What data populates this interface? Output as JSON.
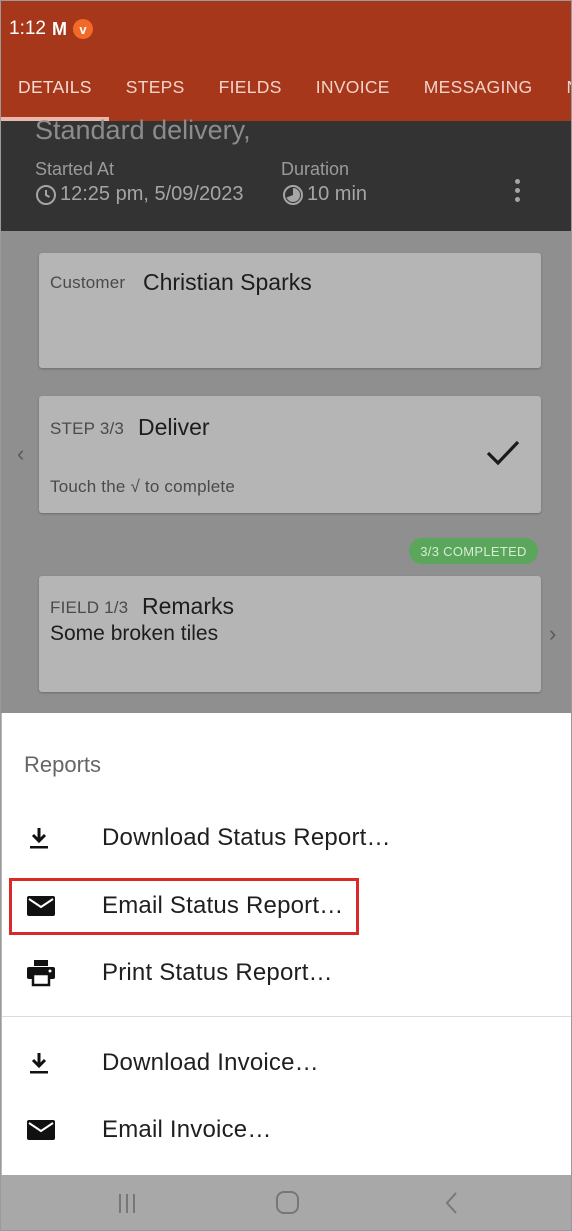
{
  "status_bar": {
    "time": "1:12",
    "gmail_glyph": "M",
    "badge_letter": "v"
  },
  "tabs": [
    {
      "label": "DETAILS",
      "active": true
    },
    {
      "label": "STEPS",
      "active": false
    },
    {
      "label": "FIELDS",
      "active": false
    },
    {
      "label": "INVOICE",
      "active": false
    },
    {
      "label": "MESSAGING",
      "active": false
    },
    {
      "label": "N",
      "active": false
    }
  ],
  "job": {
    "title": "Standard delivery,",
    "started_label": "Started At",
    "started_value": "12:25 pm, 5/09/2023",
    "duration_label": "Duration",
    "duration_value": "10 min"
  },
  "customer_card": {
    "label": "Customer",
    "name": "Christian Sparks"
  },
  "step_card": {
    "label": "STEP 3/3",
    "name": "Deliver",
    "hint": "Touch the √ to complete"
  },
  "completed_badge": "3/3 COMPLETED",
  "field_card": {
    "label": "FIELD 1/3",
    "name": "Remarks",
    "value": "Some broken tiles"
  },
  "sheet": {
    "title": "Reports",
    "items": [
      {
        "label": "Download Status Report…",
        "icon": "download-icon"
      },
      {
        "label": "Email Status Report…",
        "icon": "email-icon"
      },
      {
        "label": "Print Status Report…",
        "icon": "print-icon"
      },
      {
        "label": "Download Invoice…",
        "icon": "download-icon"
      },
      {
        "label": "Email Invoice…",
        "icon": "email-icon"
      }
    ]
  },
  "colors": {
    "app_bar": "#a7371a",
    "highlight": "#d92a2a",
    "completed_badge": "#5aa65a"
  }
}
